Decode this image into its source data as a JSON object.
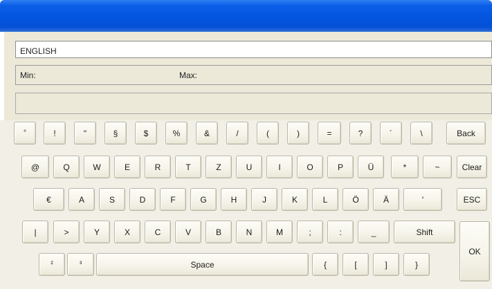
{
  "window": {
    "title": ""
  },
  "language_field": {
    "value": "ENGLISH"
  },
  "range": {
    "min_label": "Min:",
    "max_label": "Max:"
  },
  "input": {
    "value": ""
  },
  "keyboard": {
    "row1": [
      "°",
      "!",
      "\"",
      "§",
      "$",
      "%",
      "&",
      "/",
      "(",
      ")",
      "=",
      "?",
      "´",
      "\\",
      "Back"
    ],
    "row2": [
      "@",
      "Q",
      "W",
      "E",
      "R",
      "T",
      "Z",
      "U",
      "I",
      "O",
      "P",
      "Ü",
      "*",
      "~",
      "Clear"
    ],
    "row3": [
      "€",
      "A",
      "S",
      "D",
      "F",
      "G",
      "H",
      "J",
      "K",
      "L",
      "Ö",
      "Ä",
      "'",
      "ESC"
    ],
    "row4": [
      "|",
      ">",
      "Y",
      "X",
      "C",
      "V",
      "B",
      "N",
      "M",
      ";",
      ":",
      "_",
      "Shift"
    ],
    "row5": [
      "²",
      "³",
      "Space",
      "{",
      "[",
      "]",
      "}"
    ],
    "ok": "OK"
  }
}
